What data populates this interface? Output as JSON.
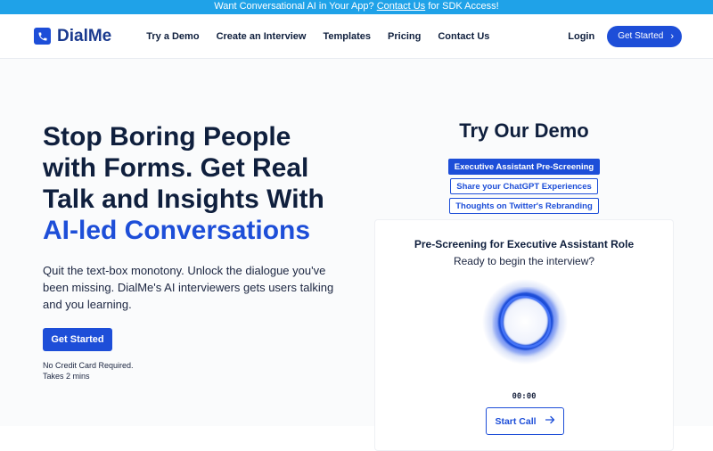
{
  "banner": {
    "prefix": "Want Conversational AI in Your App?",
    "link": "Contact Us",
    "suffix": "for SDK Access!"
  },
  "nav": {
    "brand": "DialMe",
    "links": [
      "Try a Demo",
      "Create an Interview",
      "Templates",
      "Pricing",
      "Contact Us"
    ],
    "login": "Login",
    "cta": "Get Started"
  },
  "hero": {
    "headline_main": "Stop Boring People with Forms. Get Real Talk and Insights With",
    "headline_accent": "AI-led Conversations",
    "subtext": "Quit the text-box monotony. Unlock the dialogue you've been missing. DialMe's AI interviewers gets users talking and you learning.",
    "cta": "Get Started",
    "note_1": "No Credit Card Required.",
    "note_2": "Takes 2 mins"
  },
  "demo": {
    "title": "Try Our Demo",
    "tabs": [
      "Executive Assistant Pre-Screening",
      "Share your ChatGPT Experiences",
      "Thoughts on Twitter's Rebranding"
    ],
    "active_tab": 0,
    "card_title": "Pre-Screening for Executive Assistant Role",
    "card_sub": "Ready to begin the interview?",
    "timer": "00:00",
    "start_call": "Start Call"
  },
  "colors": {
    "brand": "#1d4ed8",
    "banner": "#1fa2e8",
    "text": "#0f1f3d"
  }
}
